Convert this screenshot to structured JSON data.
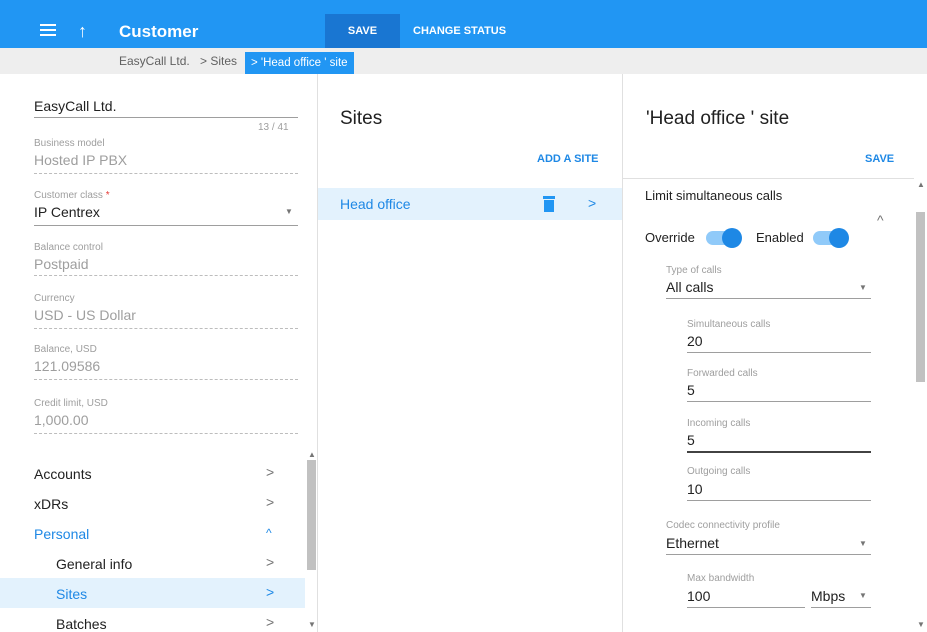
{
  "header": {
    "title": "Customer",
    "save_label": "SAVE",
    "change_status_label": "CHANGE STATUS"
  },
  "breadcrumb": {
    "items": [
      "EasyCall Ltd.",
      "> Sites",
      "> 'Head office ' site"
    ]
  },
  "customer": {
    "name": "EasyCall Ltd.",
    "name_counter": "13 / 41",
    "business_model_label": "Business model",
    "business_model_value": "Hosted IP PBX",
    "customer_class_label": "Customer class",
    "customer_class_required": "*",
    "customer_class_value": "IP Centrex",
    "balance_control_label": "Balance control",
    "balance_control_value": "Postpaid",
    "currency_label": "Currency",
    "currency_value": "USD - US Dollar",
    "balance_label": "Balance, USD",
    "balance_value": "121.09586",
    "credit_limit_label": "Credit limit, USD",
    "credit_limit_value": "1,000.00"
  },
  "nav": {
    "accounts": "Accounts",
    "xdrs": "xDRs",
    "personal": "Personal",
    "general_info": "General info",
    "sites": "Sites",
    "batches": "Batches"
  },
  "sites_panel": {
    "title": "Sites",
    "add_site_label": "ADD A SITE",
    "sites": [
      {
        "name": "Head office"
      }
    ]
  },
  "site_panel": {
    "title": "'Head office ' site",
    "save_label": "SAVE",
    "section_title": "Limit simultaneous calls",
    "override_label": "Override",
    "enabled_label": "Enabled",
    "override_on": true,
    "enabled_on": true,
    "type_of_calls_label": "Type of calls",
    "type_of_calls_value": "All calls",
    "simultaneous_label": "Simultaneous calls",
    "simultaneous_value": "20",
    "forwarded_label": "Forwarded calls",
    "forwarded_value": "5",
    "incoming_label": "Incoming calls",
    "incoming_value": "5",
    "outgoing_label": "Outgoing calls",
    "outgoing_value": "10",
    "codec_label": "Codec connectivity profile",
    "codec_value": "Ethernet",
    "max_bandwidth_label": "Max bandwidth",
    "max_bandwidth_value": "100",
    "bandwidth_unit": "Mbps"
  },
  "colors": {
    "primary": "#2196f3",
    "primary_dark": "#1976d2",
    "breadcrumb_bg": "#eeeeee",
    "selected_row_bg": "#e3f2fd"
  }
}
